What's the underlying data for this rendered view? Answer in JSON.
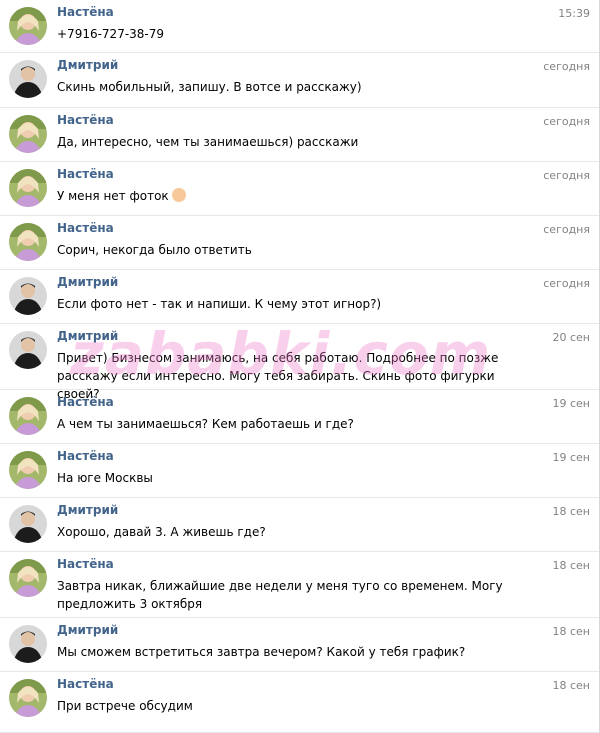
{
  "messages": [
    {
      "author": "Настёна",
      "avatar": "female",
      "time": "15:39",
      "text": "+7916-727-38-79"
    },
    {
      "author": "Дмитрий",
      "avatar": "male",
      "time": "сегодня",
      "text": "Скинь мобильный, запишу. В вотсе и расскажу)"
    },
    {
      "author": "Настёна",
      "avatar": "female",
      "time": "сегодня",
      "text": "Да, интересно, чем ты занимаешься) расскажи"
    },
    {
      "author": "Настёна",
      "avatar": "female",
      "time": "сегодня",
      "text": "У меня нет фоток",
      "emoji": "woman-gesturing-icon"
    },
    {
      "author": "Настёна",
      "avatar": "female",
      "time": "сегодня",
      "text": "Сорич, некогда было ответить"
    },
    {
      "author": "Дмитрий",
      "avatar": "male",
      "time": "сегодня",
      "text": "Если фото нет - так и напиши. К чему этот игнор?)"
    },
    {
      "author": "Дмитрий",
      "avatar": "male",
      "time": "20 сен",
      "text": "Привет) Бизнесом занимаюсь, на себя работаю. Подробнее по позже расскажу если интересно. Могу тебя забирать. Скинь фото фигурки своей?"
    },
    {
      "author": "Настёна",
      "avatar": "female",
      "time": "19 сен",
      "text": "А чем ты занимаешься? Кем работаешь и где?"
    },
    {
      "author": "Настёна",
      "avatar": "female",
      "time": "19 сен",
      "text": "На юге Москвы"
    },
    {
      "author": "Дмитрий",
      "avatar": "male",
      "time": "18 сен",
      "text": "Хорошо, давай 3. А живешь где?"
    },
    {
      "author": "Настёна",
      "avatar": "female",
      "time": "18 сен",
      "text": "Завтра никак, ближайшие две недели у меня туго со временем. Могу предложить 3 октября"
    },
    {
      "author": "Дмитрий",
      "avatar": "male",
      "time": "18 сен",
      "text": "Мы сможем встретиться завтра вечером? Какой у тебя график?"
    },
    {
      "author": "Настёна",
      "avatar": "female",
      "time": "18 сен",
      "text": "При встрече обсудим"
    }
  ],
  "watermark": "zababki.com",
  "colors": {
    "name": "#42648b",
    "time": "#828282",
    "divider": "#e7e8ec"
  }
}
